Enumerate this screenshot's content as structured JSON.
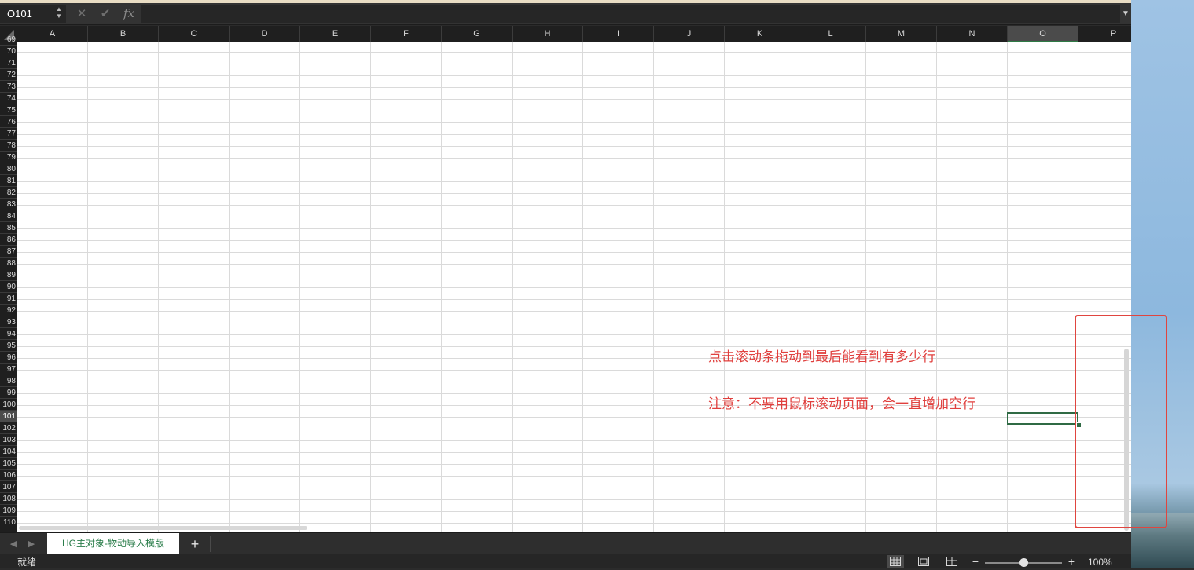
{
  "formula_bar": {
    "cell_ref": "O101",
    "cancel_icon": "✕",
    "confirm_icon": "✔",
    "fx_label": "fx",
    "formula_value": "",
    "dropdown_icon": "▼"
  },
  "columns": [
    "A",
    "B",
    "C",
    "D",
    "E",
    "F",
    "G",
    "H",
    "I",
    "J",
    "K",
    "L",
    "M",
    "N",
    "O",
    "P"
  ],
  "selected_column": "O",
  "partial_row": "69",
  "rows": [
    "70",
    "71",
    "72",
    "73",
    "74",
    "75",
    "76",
    "77",
    "78",
    "79",
    "80",
    "81",
    "82",
    "83",
    "84",
    "85",
    "86",
    "87",
    "88",
    "89",
    "90",
    "91",
    "92",
    "93",
    "94",
    "95",
    "96",
    "97",
    "98",
    "99",
    "100",
    "101",
    "102",
    "103",
    "104",
    "105",
    "106",
    "107",
    "108",
    "109",
    "110"
  ],
  "selected_row": "101",
  "annotations": {
    "line1": "点击滚动条拖动到最后能看到有多少行",
    "line2": "注意：不要用鼠标滚动页面，会一直增加空行"
  },
  "tabs": {
    "prev_icon": "◀",
    "next_icon": "▶",
    "sheet_name": "HG主对象-物动导入模版",
    "add_label": "+"
  },
  "status": {
    "ready_text": "就绪",
    "zoom_minus": "−",
    "zoom_plus": "+",
    "zoom_level": "100%",
    "zoom_fraction": 0.5
  },
  "colors": {
    "annotation": "#e0403e",
    "selection": "#2f6a44",
    "sheet_tab_text": "#2a7d4a"
  }
}
